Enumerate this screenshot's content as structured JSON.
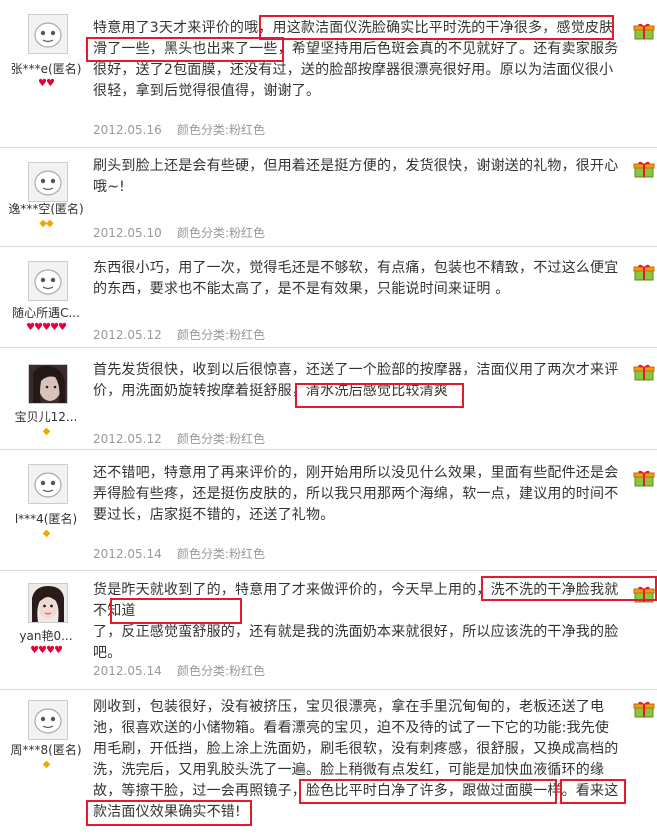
{
  "reviews": [
    {
      "user": "张***e(匿名)",
      "rank_icon": "heart",
      "rank_count": 2,
      "lines": [
        "特意用了3天才来评价的哦，用这款洁面仪洗脸确实比平时洗的干净很多，感觉皮肤",
        "滑了一些，黑头也出来了一些，希望坚持用后色斑会真的不见就好了。还有卖家服务",
        "很好，送了2包面膜，还没有过，送的脸部按摩器很漂亮很好用。原以为洁面仪很小",
        "很轻，拿到后觉得很值得，谢谢了。"
      ],
      "date": "2012.05.16",
      "color": "颜色分类:粉红色"
    },
    {
      "user": "逸***空(匿名)",
      "rank_icon": "diamond",
      "rank_count": 2,
      "lines": [
        "刷头到脸上还是会有些硬，但用着还是挺方便的，发货很快，谢谢送的礼物，很开心",
        "哦~!"
      ],
      "date": "2012.05.10",
      "color": "颜色分类:粉红色"
    },
    {
      "user": "随心所遇C...",
      "rank_icon": "heart",
      "rank_count": 5,
      "lines": [
        "东西很小巧，用了一次，觉得毛还是不够软，有点痛，包装也不精致，不过这么便宜",
        "的东西，要求也不能太高了，是不是有效果，只能说时间来证明 。"
      ],
      "date": "2012.05.12",
      "color": "颜色分类:粉红色"
    },
    {
      "user": "宝贝儿12...",
      "rank_icon": "diamond",
      "rank_count": 1,
      "lines": [
        "首先发货很快，收到以后很惊喜，还送了一个脸部的按摩器，洁面仪用了两次才来评",
        "价，用洗面奶旋转按摩着挺舒服，清水洗后感觉比较清爽"
      ],
      "date": "2012.05.12",
      "color": "颜色分类:粉红色"
    },
    {
      "user": "l***4(匿名)",
      "rank_icon": "diamond",
      "rank_count": 1,
      "lines": [
        "还不错吧，特意用了再来评价的，刚开始用所以没见什么效果，里面有些配件还是会",
        "弄得脸有些疼，还是挺伤皮肤的，所以我只用那两个海绵，软一点，建议用的时间不",
        "要过长，店家挺不错的，还送了礼物。"
      ],
      "date": "2012.05.14",
      "color": "颜色分类:粉红色"
    },
    {
      "user": "yan艳0...",
      "rank_icon": "heart",
      "rank_count": 4,
      "lines": [
        "货是昨天就收到了的，特意用了才来做评价的，今天早上用的，洗不洗的干净脸我就不知道",
        "了，反正感觉蛮舒服的，还有就是我的洗面奶本来就很好，所以应该洗的干净我的脸",
        "吧。"
      ],
      "date": "2012.05.14",
      "color": "颜色分类:粉红色"
    },
    {
      "user": "周***8(匿名)",
      "rank_icon": "diamond",
      "rank_count": 1,
      "lines": [
        "刚收到，包装很好，没有被挤压，宝贝很漂亮，拿在手里沉甸甸的，老板还送了电",
        "池，很喜欢送的小储物箱。看看漂亮的宝贝，迫不及待的试了一下它的功能:我先使",
        "用毛刷，开低挡，脸上涂上洗面奶，刷毛很软，没有刺疼感，很舒服，又换成高档的",
        "洗，洗完后，又用乳胶头洗了一遍。脸上稍微有点发红，可能是加快血液循环的缘",
        "故，等擦干脸，过一会再照镜子，脸色比平时白净了许多，跟做过面膜一样。看来这",
        "款洁面仪效果确实不错!"
      ],
      "date": "",
      "color": ""
    }
  ],
  "colors": {
    "highlight": "#e8192c",
    "meta_text": "#999999",
    "heart_rank": "#e5003a",
    "diamond_rank": "#f0a800"
  },
  "icons": {
    "avatar_default": "ghost-face-icon",
    "avatar_photo": "user-photo-icon",
    "gift": "gift-box-icon"
  }
}
